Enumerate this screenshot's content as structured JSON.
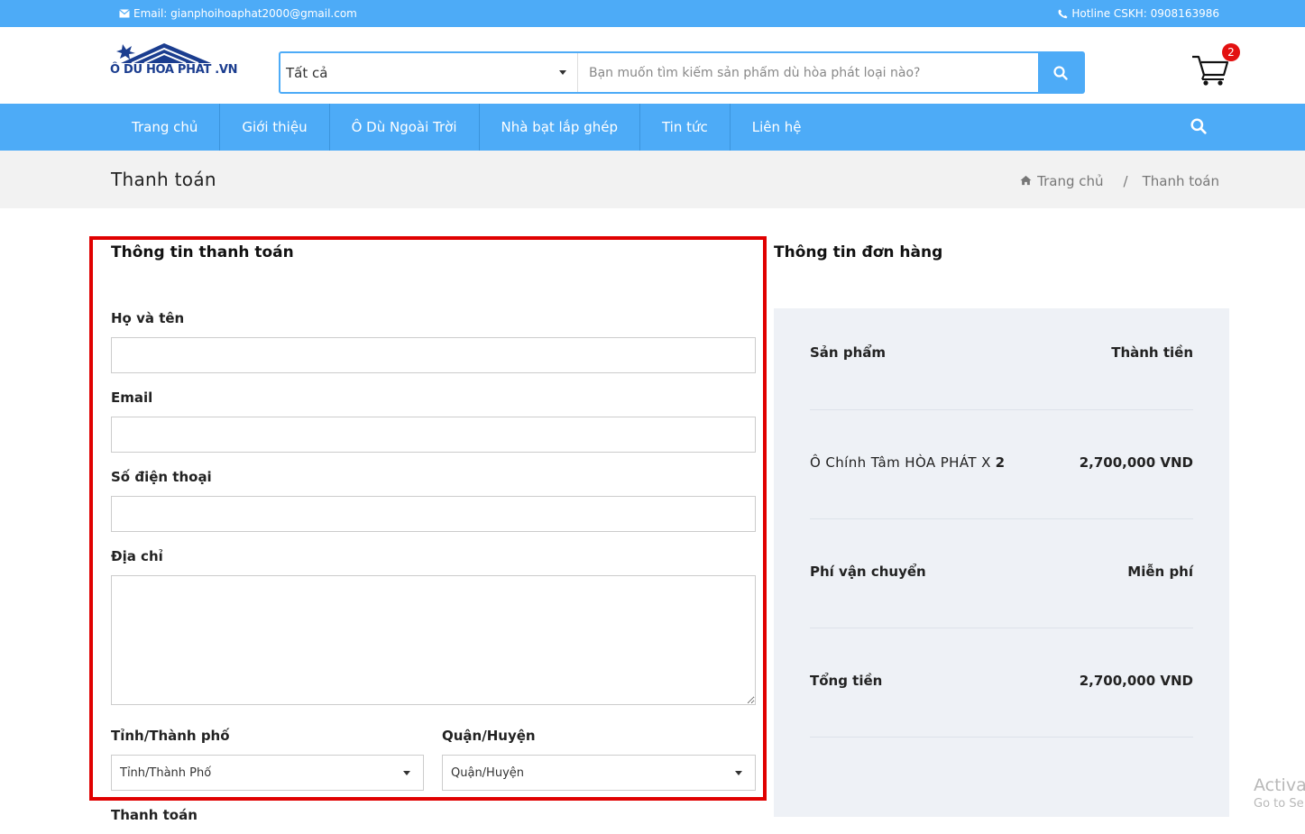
{
  "topbar": {
    "email": "Email: gianphoihoaphat2000@gmail.com",
    "hotline": "Hotline CSKH: 0908163986"
  },
  "header": {
    "logo_text": "Ô DÙ HÒA PHÁT .VN",
    "search_category": "Tất cả",
    "search_placeholder": "Bạn muốn tìm kiếm sản phẩm dù hòa phát loại nào?",
    "cart_count": "2"
  },
  "nav": {
    "items": [
      "Trang chủ",
      "Giới thiệu",
      "Ô Dù Ngoài Trời",
      "Nhà bạt lắp ghép",
      "Tin tức",
      "Liên hệ"
    ]
  },
  "breadcrumb": {
    "page_title": "Thanh toán",
    "home": "Trang chủ",
    "separator": "/",
    "current": "Thanh toán"
  },
  "billing": {
    "heading": "Thông tin thanh toán",
    "name_label": "Họ và tên",
    "email_label": "Email",
    "phone_label": "Số điện thoại",
    "address_label": "Địa chỉ",
    "province_label": "Tỉnh/Thành phố",
    "province_value": "Tỉnh/Thành Phố",
    "district_label": "Quận/Huyện",
    "district_value": "Quận/Huyện",
    "payment_label": "Thanh toán"
  },
  "order": {
    "heading": "Thông tin đơn hàng",
    "col_product": "Sản phẩm",
    "col_total": "Thành tiền",
    "product_name": "Ô Chính Tâm HÒA PHÁT X",
    "product_qty": "2",
    "product_total": "2,700,000 VND",
    "shipping_label": "Phí vận chuyển",
    "shipping_value": "Miễn phí",
    "grand_total_label": "Tổng tiền",
    "grand_total_value": "2,700,000 VND"
  },
  "watermark": {
    "line1": "Activat",
    "line2": "Go to Se"
  },
  "colors": {
    "brand_blue": "#4dabf7",
    "highlight_red": "#e00000",
    "summary_bg": "#eef1f6",
    "badge_red": "#e31111"
  }
}
